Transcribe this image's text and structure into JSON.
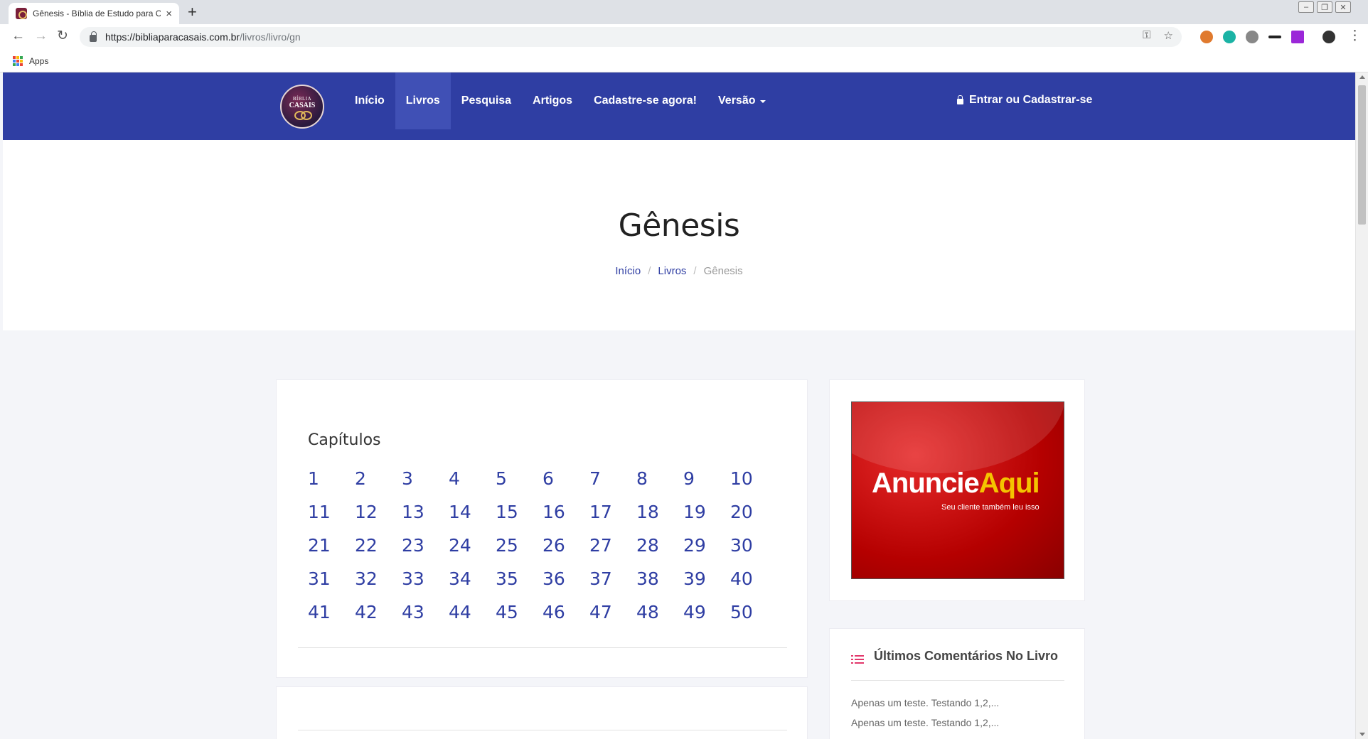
{
  "browser": {
    "tab_title": "Gênesis - Bíblia de Estudo para Casais",
    "tab_close": "×",
    "new_tab": "+",
    "nav": {
      "back": "←",
      "forward": "→",
      "reload": "↻"
    },
    "url_host": "https://bibliaparacasais.com.br",
    "url_path": "/livros/livro/gn",
    "key_icon": "⚿",
    "star_icon": "☆",
    "menu_icon": "⋮",
    "bookmarks_apps": "Apps",
    "window": {
      "minimize": "–",
      "restore": "❐",
      "close": "✕"
    }
  },
  "site": {
    "logo_top": "BÍBLIA",
    "logo_main": "CASAIS",
    "menu": [
      "Início",
      "Livros",
      "Pesquisa",
      "Artigos",
      "Cadastre-se agora!",
      "Versão"
    ],
    "active_menu": "Livros",
    "login": "Entrar ou Cadastrar-se"
  },
  "hero": {
    "title": "Gênesis",
    "breadcrumb": [
      "Início",
      "Livros",
      "Gênesis"
    ],
    "separator": "/"
  },
  "chapters": {
    "heading": "Capítulos",
    "items": [
      "1",
      "2",
      "3",
      "4",
      "5",
      "6",
      "7",
      "8",
      "9",
      "10",
      "11",
      "12",
      "13",
      "14",
      "15",
      "16",
      "17",
      "18",
      "19",
      "20",
      "21",
      "22",
      "23",
      "24",
      "25",
      "26",
      "27",
      "28",
      "29",
      "30",
      "31",
      "32",
      "33",
      "34",
      "35",
      "36",
      "37",
      "38",
      "39",
      "40",
      "41",
      "42",
      "43",
      "44",
      "45",
      "46",
      "47",
      "48",
      "49",
      "50"
    ]
  },
  "ad": {
    "word1": "Anuncie",
    "word2": "Aqui",
    "tagline": "Seu cliente também leu isso"
  },
  "comments": {
    "heading": "Últimos Comentários No Livro",
    "items": [
      "Apenas um teste. Testando 1,2,...",
      "Apenas um teste. Testando 1,2,..."
    ]
  },
  "colors": {
    "navbar": "#2f3ea3",
    "navbar_active": "#4050b5",
    "link": "#2f3ea3",
    "accent_icon": "#e2386b",
    "page_bg": "#f4f5f9"
  }
}
